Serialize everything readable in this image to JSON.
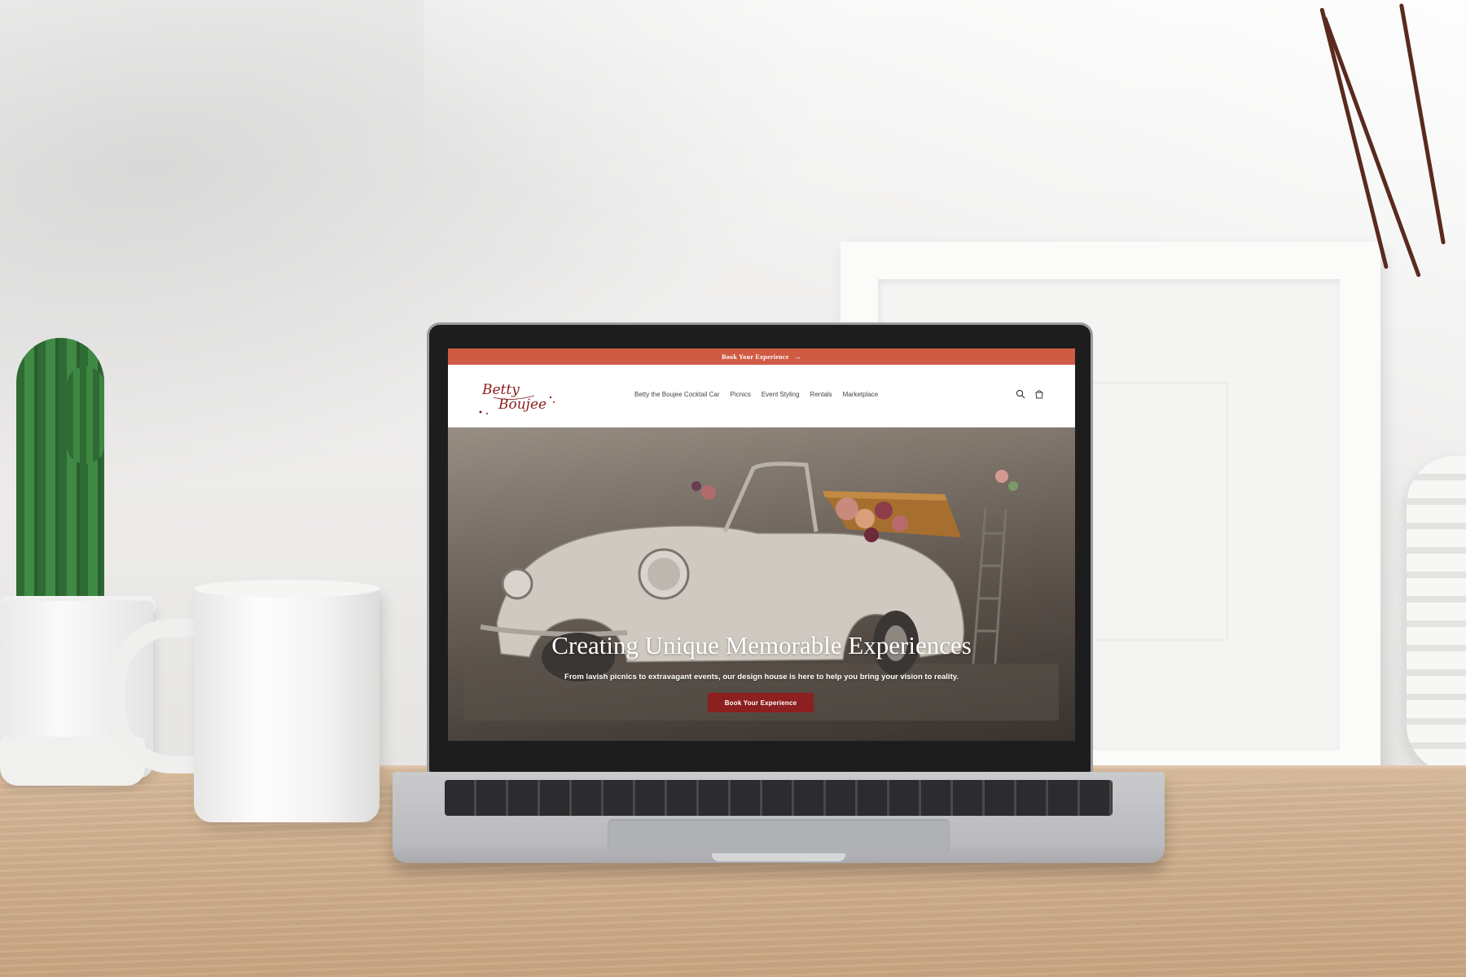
{
  "announcement": {
    "label": "Book Your Experience",
    "arrow_icon": "→"
  },
  "header": {
    "logo_line1": "Betty",
    "logo_line2": "Boujee",
    "nav": [
      "Betty the Boujee Cocktail Car",
      "Picnics",
      "Event Styling",
      "Rentals",
      "Marketplace"
    ],
    "icons": [
      "search-icon",
      "cart-icon"
    ]
  },
  "hero": {
    "title": "Creating Unique Memorable Experiences",
    "subtitle": "From lavish picnics to extravagant events, our design house is here to help you bring your vision to reality.",
    "button_label": "Book Your Experience"
  },
  "colors": {
    "announcement_bg": "#d05b44",
    "button_bg": "#8c1f1f",
    "logo": "#8a1c1c"
  }
}
